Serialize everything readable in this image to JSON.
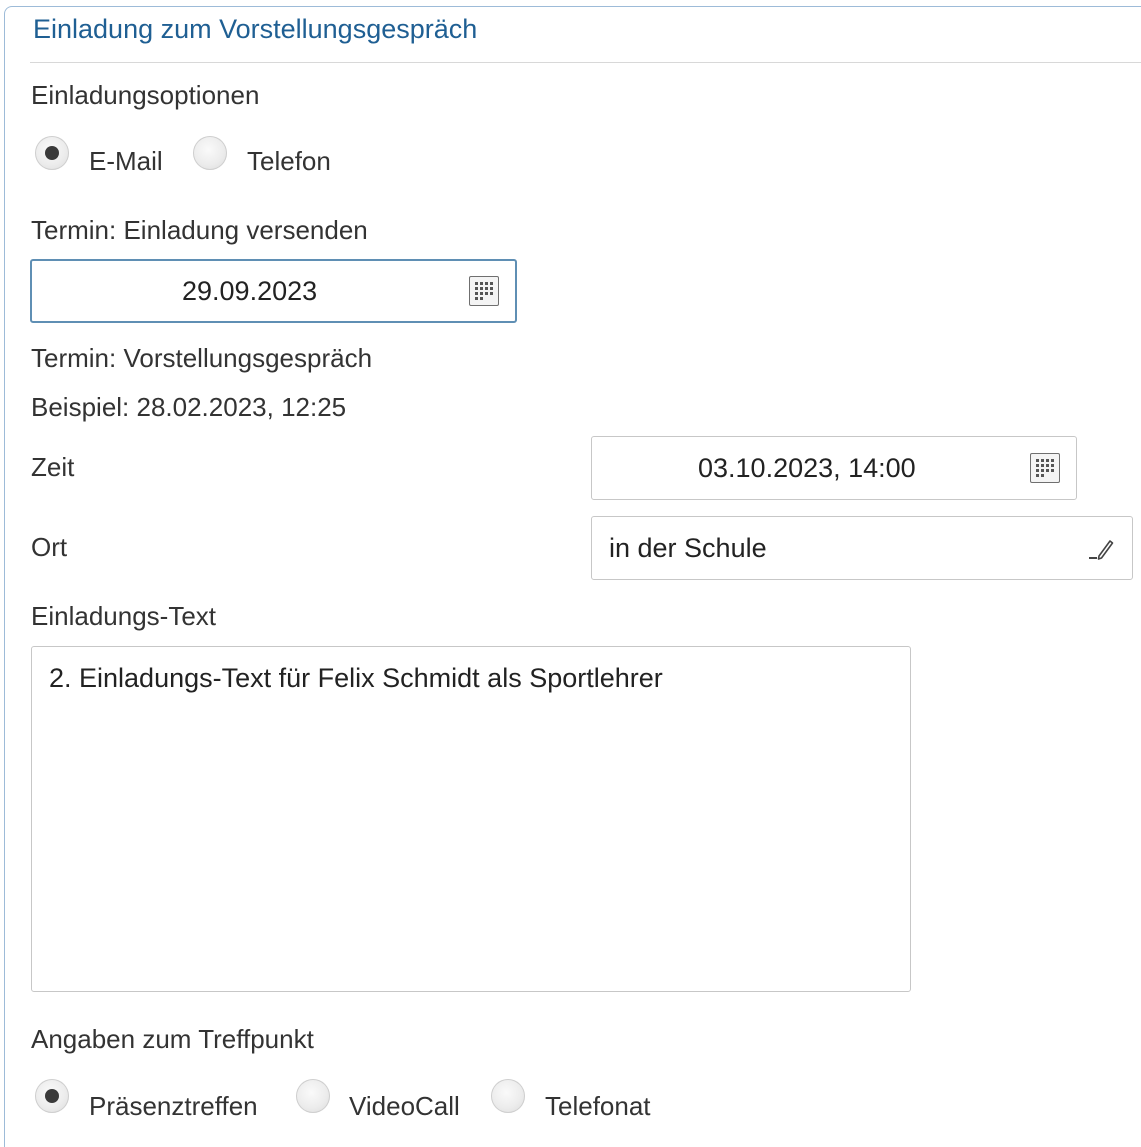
{
  "panel": {
    "title": "Einladung zum Vorstellungsgespräch"
  },
  "invitation_options": {
    "label": "Einladungsoptionen",
    "options": [
      {
        "label": "E-Mail",
        "selected": true
      },
      {
        "label": "Telefon",
        "selected": false
      }
    ]
  },
  "send_date": {
    "label": "Termin: Einladung versenden",
    "value": "29.09.2023",
    "icon": "calendar-icon"
  },
  "interview": {
    "label": "Termin: Vorstellungsgespräch",
    "example": "Beispiel: 28.02.2023, 12:25",
    "time_label": "Zeit",
    "time_value": "03.10.2023, 14:00",
    "time_icon": "calendar-icon",
    "place_label": "Ort",
    "place_value": "in der Schule",
    "place_icon": "pencil-icon"
  },
  "invitation_text": {
    "label": "Einladungs-Text",
    "value": "2. Einladungs-Text für Felix Schmidt als Sportlehrer"
  },
  "meeting": {
    "label": "Angaben zum Treffpunkt",
    "options": [
      {
        "label": "Präsenztreffen",
        "selected": true
      },
      {
        "label": "VideoCall",
        "selected": false
      },
      {
        "label": "Telefonat",
        "selected": false
      }
    ]
  },
  "colors": {
    "title": "#1f5f93",
    "panel_border": "#9dbbd8",
    "focused_border": "#5f8fb4",
    "text": "#333333"
  }
}
